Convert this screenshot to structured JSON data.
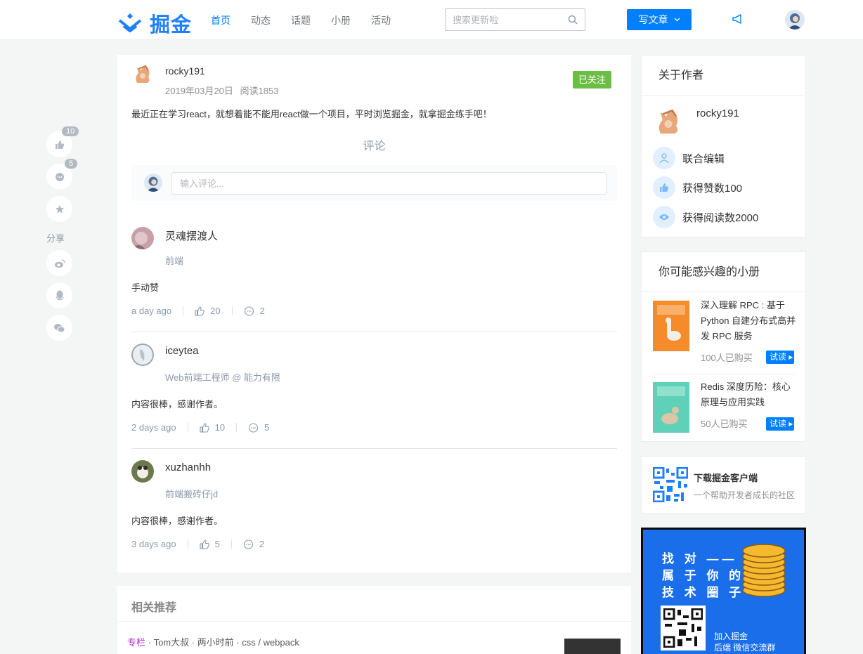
{
  "header": {
    "logo_text": "掘金",
    "nav": [
      "首页",
      "动态",
      "话题",
      "小册",
      "活动"
    ],
    "active_nav": "首页",
    "search_placeholder": "搜索更新啦",
    "write_label": "写文章"
  },
  "sidebar_actions": {
    "like_count": "10",
    "comment_count": "5",
    "share_label": "分享",
    "share_targets": [
      "weibo-icon",
      "qq-icon",
      "wechat-icon"
    ]
  },
  "post": {
    "author": "rocky191",
    "date": "2019年03月20日",
    "reads": "阅读1853",
    "follow_label": "已关注",
    "body": "最近正在学习react，就想着能不能用react做一个项目，平时浏览掘金，就拿掘金练手吧！",
    "comments_title": "评论",
    "comment_placeholder": "输入评论..."
  },
  "comments": [
    {
      "name": "灵魂摆渡人",
      "title": "前端",
      "text": "手动赞",
      "time": "a day ago",
      "likes": "20",
      "replies": "2"
    },
    {
      "name": "iceytea",
      "title": "Web前端工程师 @ 能力有限",
      "text": "内容很棒，感谢作者。",
      "time": "2 days ago",
      "likes": "10",
      "replies": "5"
    },
    {
      "name": "xuzhanhh",
      "title": "前端搬砖仔jd",
      "text": "内容很棒，感谢作者。",
      "time": "3 days ago",
      "likes": "5",
      "replies": "2"
    }
  ],
  "related": {
    "title": "相关推荐",
    "tag": "专栏",
    "meta": " · Tom大叔 · 两小时前 · css / webpack"
  },
  "about": {
    "title": "关于作者",
    "name": "rocky191",
    "rows": [
      "联合编辑",
      "获得赞数100",
      "获得阅读数2000"
    ]
  },
  "books": {
    "title": "你可能感兴趣的小册",
    "items": [
      {
        "title": "深入理解 RPC : 基于 Python 自建分布式高并发 RPC 服务",
        "buyers": "100人已购买",
        "try": "试读"
      },
      {
        "title": "Redis 深度历险：核心原理与应用实践",
        "buyers": "50人已购买",
        "try": "试读"
      }
    ]
  },
  "download": {
    "title": "下载掘金客户端",
    "subtitle": "一个帮助开发者成长的社区"
  },
  "ad": {
    "lines": [
      "找 对 ——",
      "属 于 你 的",
      "技 术 圈 子"
    ],
    "join": "加入掘金",
    "group": "后端 微信交流群"
  },
  "colors": {
    "brand": "#007fff",
    "followed": "#6cbd45",
    "page_bg": "#f4f5f5"
  }
}
